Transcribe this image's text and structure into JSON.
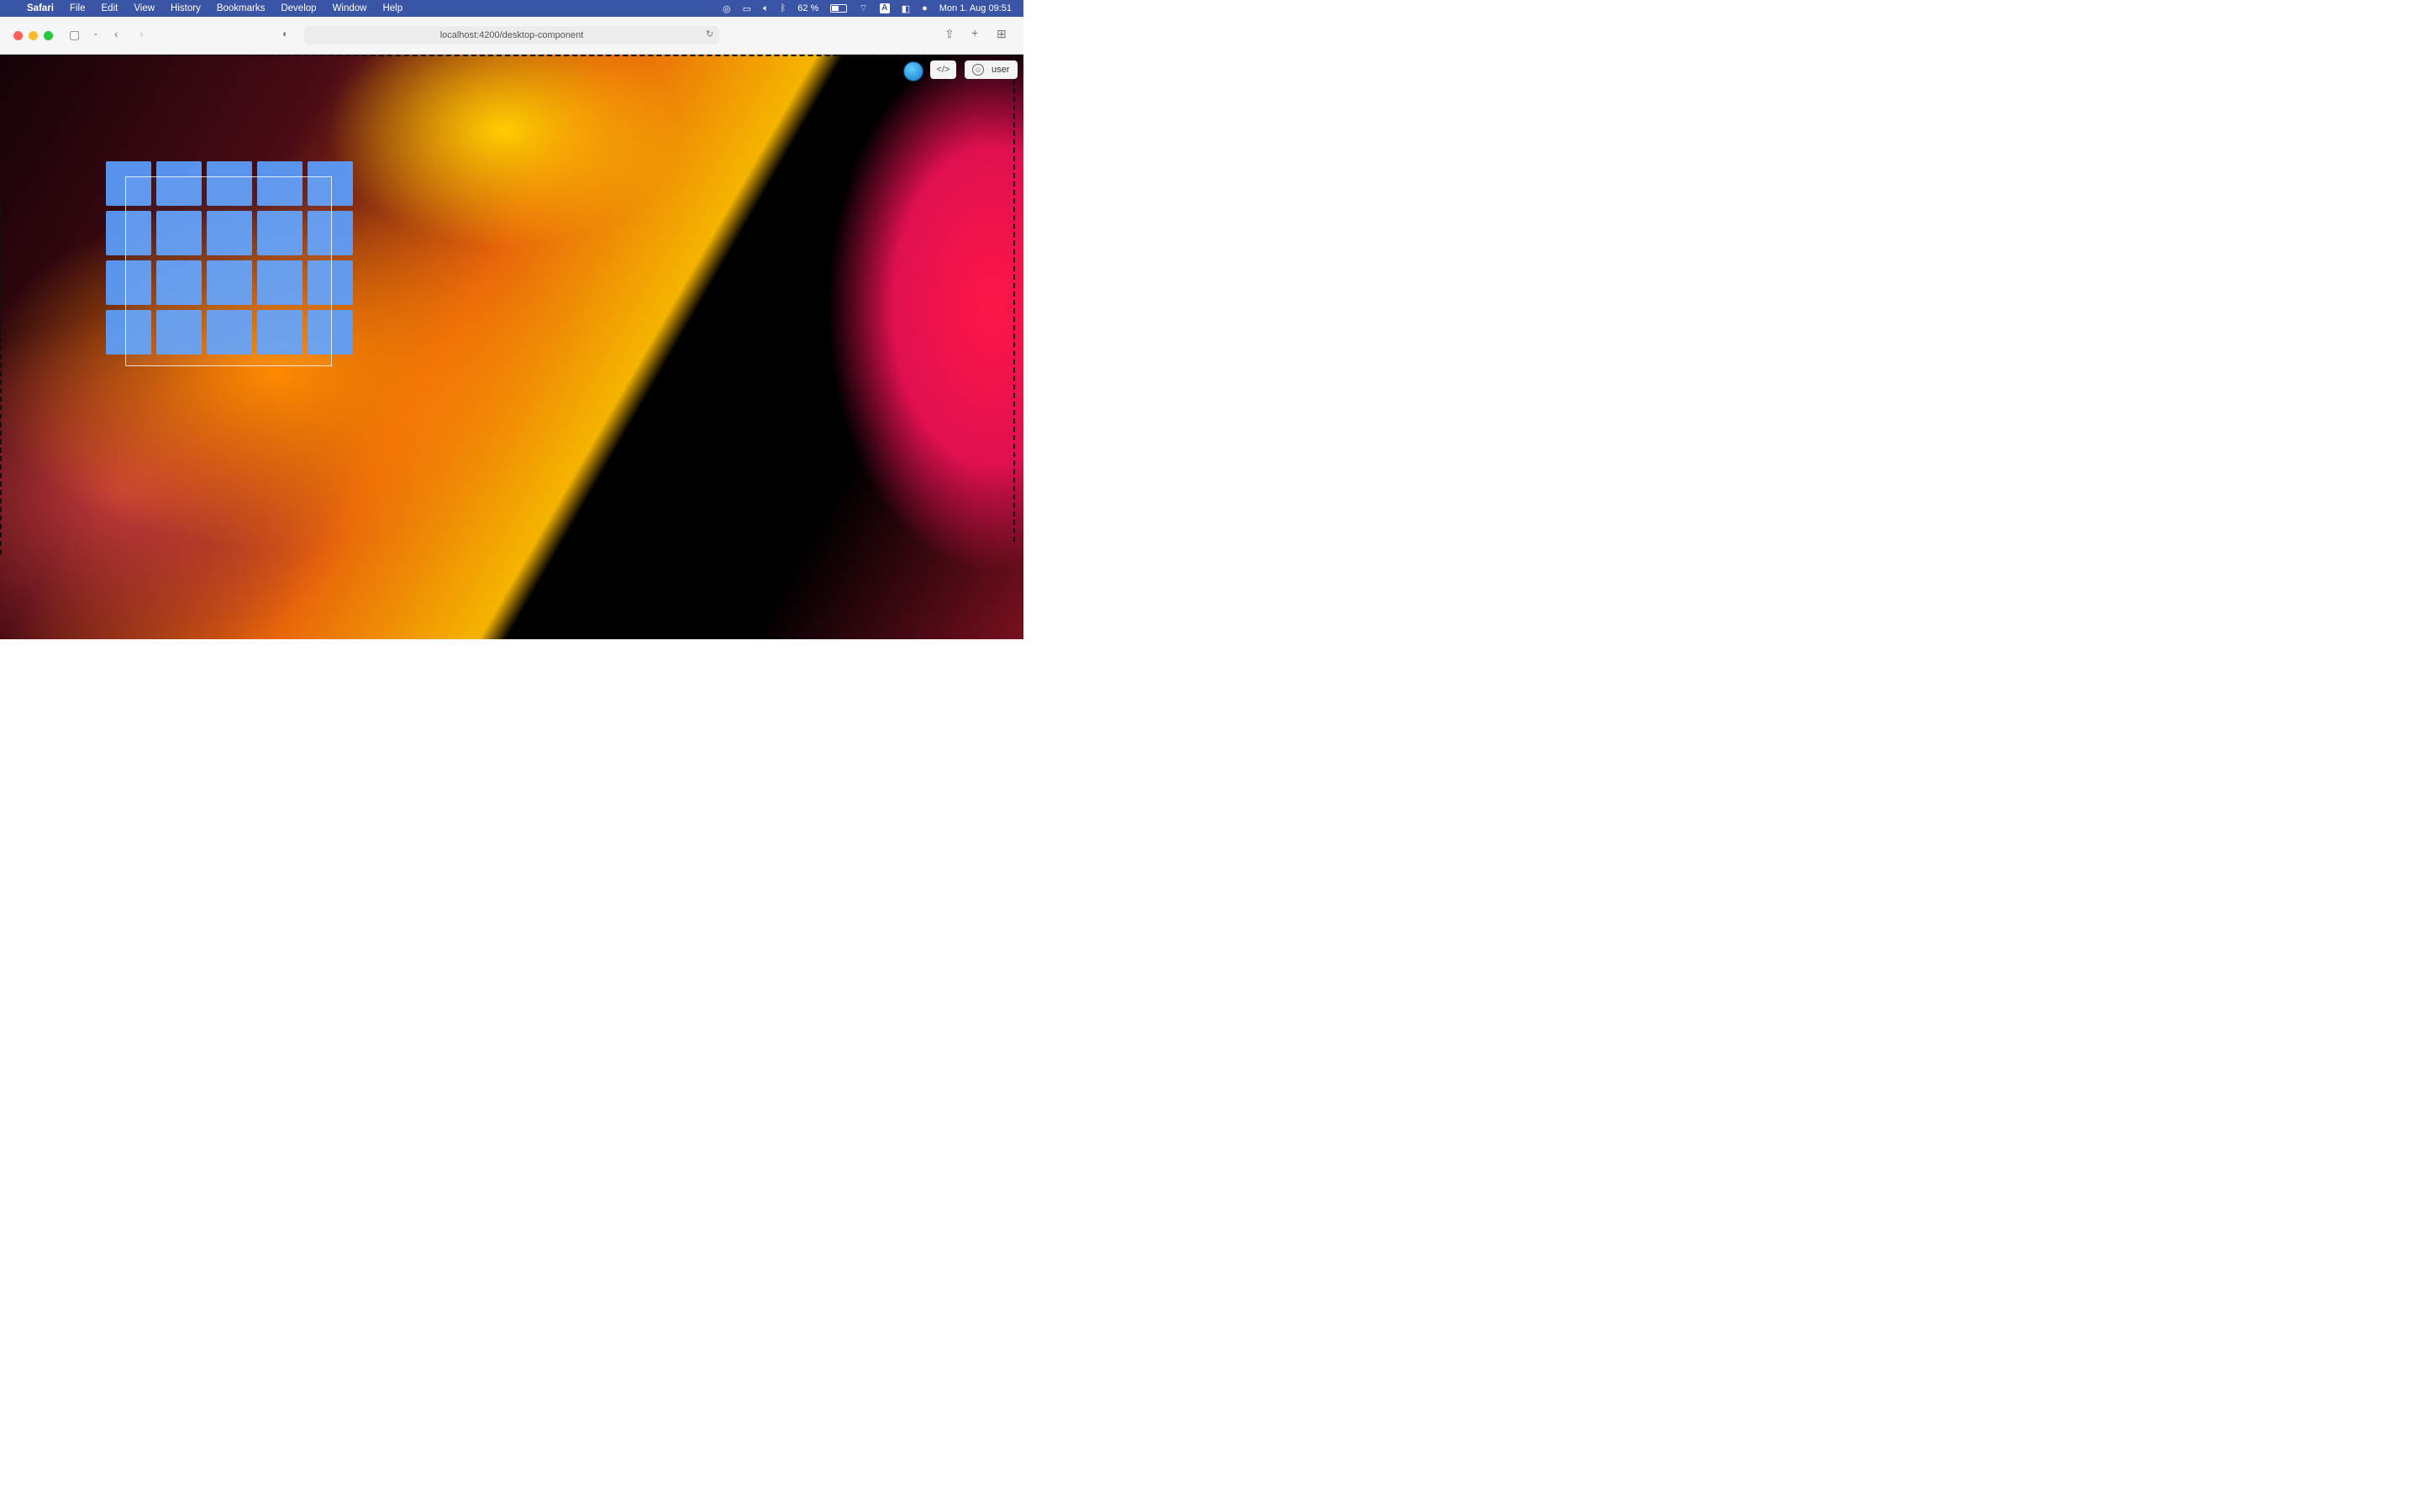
{
  "menubar": {
    "apple": "",
    "app_name": "Safari",
    "items": [
      "File",
      "Edit",
      "View",
      "History",
      "Bookmarks",
      "Develop",
      "Window",
      "Help"
    ],
    "battery_percent": "62 %",
    "input_source": "A",
    "datetime": "Mon 1. Aug  09:51"
  },
  "browser": {
    "url": "localhost:4200/desktop-component"
  },
  "topright": {
    "code_label": "</>",
    "user_label": "user"
  },
  "grid": {
    "rows": 4,
    "columns": 5
  },
  "dock": {
    "items": [
      "folder-icon",
      "image-viewer-icon",
      "pencil-icon",
      "terminal-icon",
      "files-icon",
      "settings-icon"
    ]
  },
  "colors": {
    "menubar": "#3b55a6",
    "tile": "#5aa0ff"
  }
}
